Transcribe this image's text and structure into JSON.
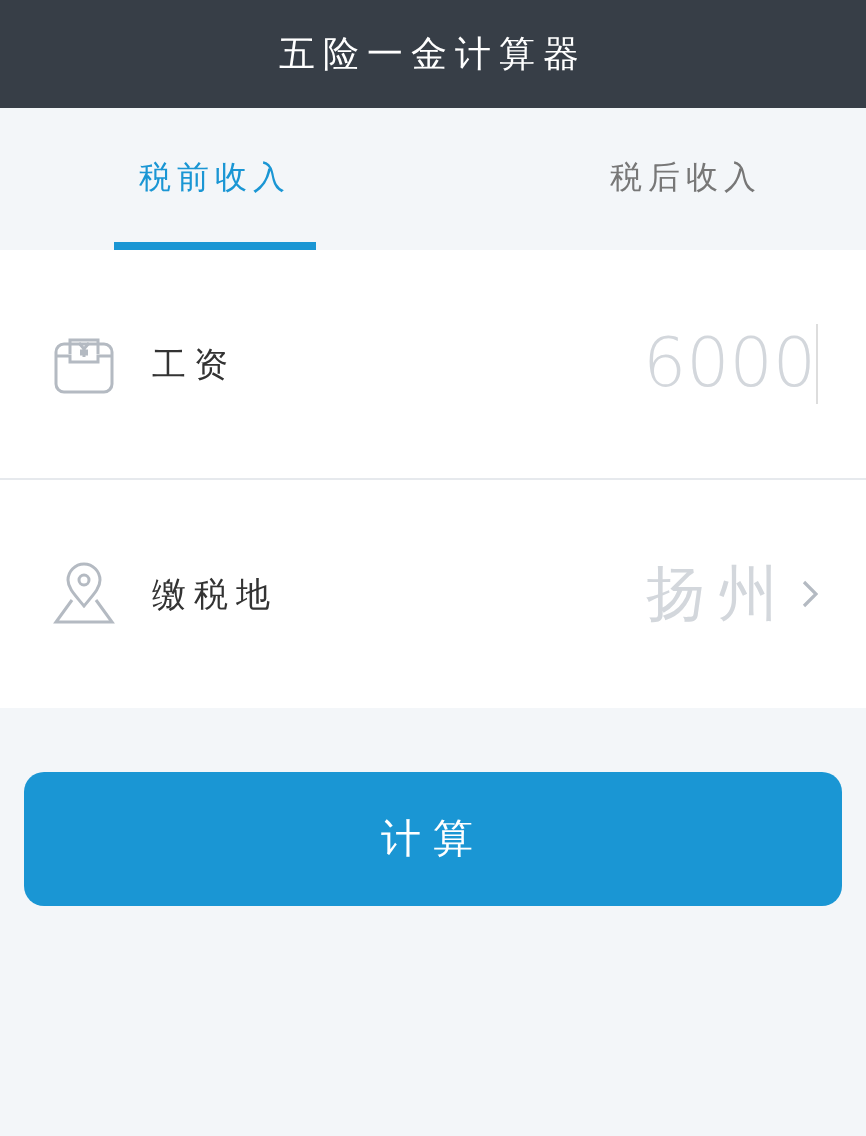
{
  "header": {
    "title": "五险一金计算器"
  },
  "tabs": [
    {
      "label": "税前收入",
      "selected": true
    },
    {
      "label": "税后收入",
      "selected": false
    }
  ],
  "rows": [
    {
      "kind": "input",
      "label": "工资",
      "placeholder": "6000"
    },
    {
      "kind": "select",
      "label": "缴税地",
      "value": "扬州"
    }
  ],
  "button": {
    "label": "计算"
  }
}
